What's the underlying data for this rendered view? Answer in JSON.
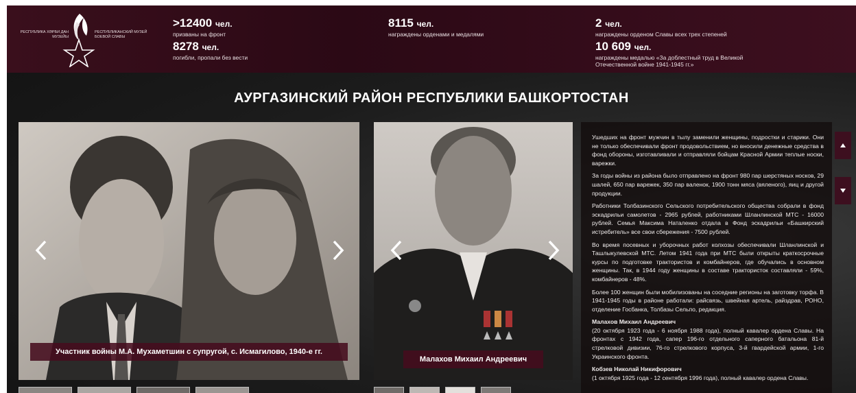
{
  "header": {
    "logo": {
      "left_text": "Республика Хәрби дан музейы",
      "right_text": "Республиканский музей боевой славы"
    },
    "stats": [
      {
        "number": ">12400",
        "unit": "чел.",
        "desc": "призваны на фронт"
      },
      {
        "number": "8278",
        "unit": "чел.",
        "desc": "погибли, пропали без вести"
      },
      {
        "number": "8115",
        "unit": "чел.",
        "desc": "награждены орденами и медалями"
      },
      {
        "number": "2",
        "unit": "чел.",
        "desc": "награждены орденом Славы всех трех степеней"
      },
      {
        "number": "10 609",
        "unit": "чел.",
        "desc": "награждены медалью «За доблестный труд в Великой Отечественной войне 1941-1945 гг.»"
      }
    ]
  },
  "title": "АУРГАЗИНСКИЙ РАЙОН РЕСПУБЛИКИ БАШКОРТОСТАН",
  "slider1": {
    "caption": "Участник войны М.А. Мухаметшин с супругой, с. Исмагилово, 1940-е гг."
  },
  "slider2": {
    "caption": "Малахов Михаил Андреевич"
  },
  "text": {
    "paragraphs": [
      "Ушедших на фронт мужчин в тылу заменили женщины, подростки и старики. Они не только обеспечивали фронт продовольствием, но вносили денежные средства в фонд обороны, изготавливали и отправляли бойцам Красной Армии теплые носки, варежки.",
      "За годы войны из района было отправлено на фронт 980 пар шерстяных носков, 29 шалей, 650 пар варежек, 350 пар валенок, 1900 тонн мяса (вяленого), яиц и другой продукции.",
      "Работники Толбазинского Сельского потребительского общества собрали в фонд эскадрильи самолетов - 2965 рублей, работниками Шланлинской МТС - 16000 рублей. Семья Максима Наталенко отдала в Фонд эскадрильи «Башкирский истребитель» все свои сбережения - 7500 рублей.",
      "Во время посевных и уборочных работ колхозы обеспечивали Шланлинской и Ташлыкулевской МТС. Летом 1941 года при МТС были открыты краткосрочные курсы по подготовке трактористов и комбайнеров, где обучались в основном женщины. Так, в 1944 году женщины в составе трактористок составляли - 59%, комбайнеров - 48%.",
      "Более 100 женщин были мобилизованы на соседние регионы на заготовку торфа. В 1941-1945 годы в районе работали: райсвязь, швейная артель, райздрав, РОНО, отделение Госбанка, Толбазы Сельпо, редакция."
    ],
    "person1_name": "Малахов Михаил Андреевич",
    "person1_bio": "(20 октября 1923 года - 6 ноября 1988 года), полный кавалер ордена Славы. На фронтах с 1942 года, сапер 196-го отдельного саперного батальона 81-й стрелковой дивизии, 76-го стрелкового корпуса, 3-й гвардейской армии, 1-го Украинского фронта.",
    "person2_name": "Кобзев Николай Никифорович",
    "person2_bio": "(1 октября 1925 года - 12 сентября 1996 года), полный кавалер ордена Славы."
  },
  "icons": [
    "star-flame-logo-icon",
    "chevron-left-icon",
    "chevron-right-icon",
    "caret-up-icon",
    "caret-down-icon"
  ],
  "colors": {
    "header_bg": "#2b0915",
    "caption_bg": "#460c1e",
    "accent": "#3d0f1f"
  }
}
